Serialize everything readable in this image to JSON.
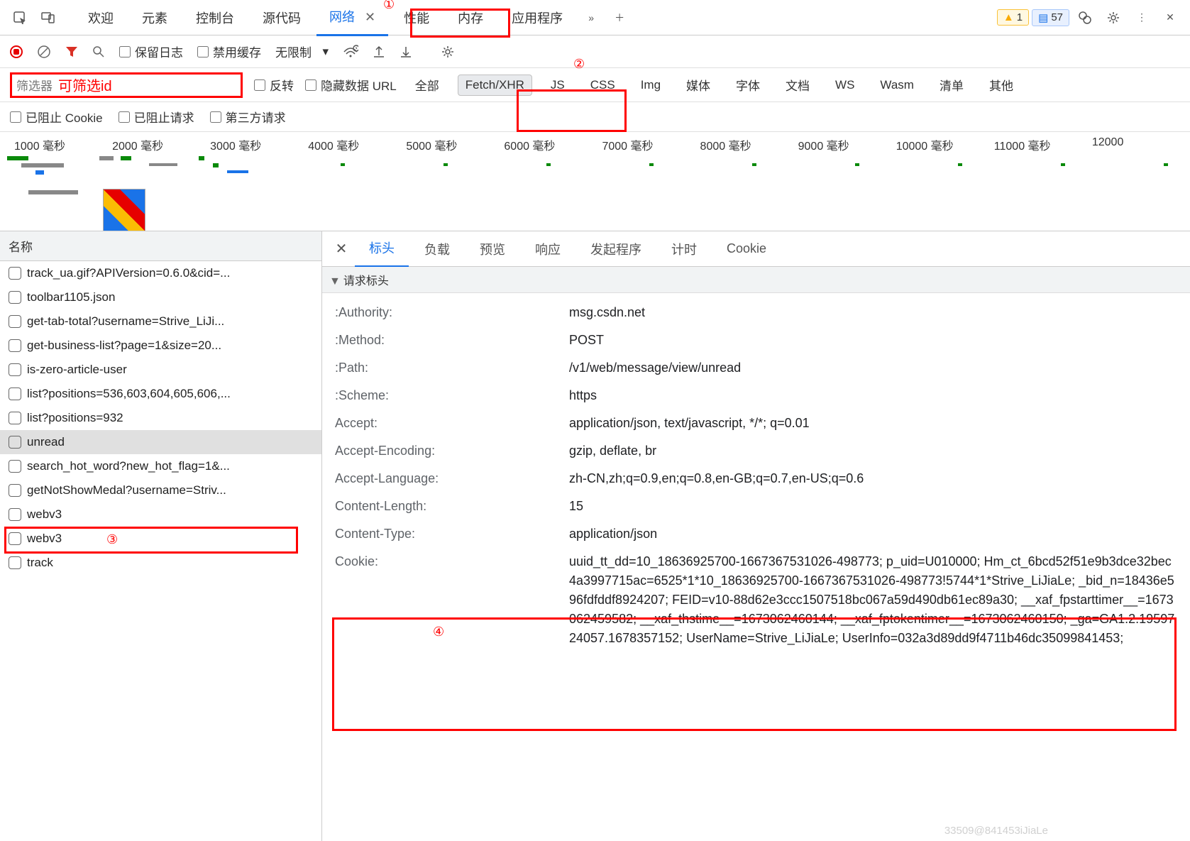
{
  "topbar": {
    "tabs": [
      "欢迎",
      "元素",
      "控制台",
      "源代码",
      "网络",
      "性能",
      "内存",
      "应用程序"
    ],
    "active_tab": "网络",
    "warn_count": "1",
    "msg_count": "57"
  },
  "toolbar": {
    "preserve_log": "保留日志",
    "disable_cache": "禁用缓存",
    "throttle": "无限制"
  },
  "filterrow": {
    "placeholder": "筛选器",
    "annotation": "可筛选id",
    "invert": "反转",
    "hide_data": "隐藏数据 URL",
    "types": [
      "全部",
      "Fetch/XHR",
      "JS",
      "CSS",
      "Img",
      "媒体",
      "字体",
      "文档",
      "WS",
      "Wasm",
      "清单",
      "其他"
    ],
    "selected_type": "Fetch/XHR"
  },
  "blockedrow": {
    "blocked_cookie": "已阻止 Cookie",
    "blocked_req": "已阻止请求",
    "third_party": "第三方请求"
  },
  "timeline": {
    "ticks": [
      "1000 毫秒",
      "2000 毫秒",
      "3000 毫秒",
      "4000 毫秒",
      "5000 毫秒",
      "6000 毫秒",
      "7000 毫秒",
      "8000 毫秒",
      "9000 毫秒",
      "10000 毫秒",
      "11000 毫秒",
      "12000"
    ]
  },
  "names": {
    "header": "名称",
    "items": [
      "track_ua.gif?APIVersion=0.6.0&cid=...",
      "toolbar1105.json",
      "get-tab-total?username=Strive_LiJi...",
      "get-business-list?page=1&size=20...",
      "is-zero-article-user",
      "list?positions=536,603,604,605,606,...",
      "list?positions=932",
      "unread",
      "search_hot_word?new_hot_flag=1&...",
      "getNotShowMedal?username=Striv...",
      "webv3",
      "webv3",
      "track"
    ],
    "selected": "unread"
  },
  "details": {
    "tabs": [
      "标头",
      "负载",
      "预览",
      "响应",
      "发起程序",
      "计时",
      "Cookie"
    ],
    "active": "标头",
    "section": "请求标头",
    "headers": [
      {
        "k": ":Authority:",
        "v": "msg.csdn.net"
      },
      {
        "k": ":Method:",
        "v": "POST"
      },
      {
        "k": ":Path:",
        "v": "/v1/web/message/view/unread"
      },
      {
        "k": ":Scheme:",
        "v": "https"
      },
      {
        "k": "Accept:",
        "v": "application/json, text/javascript, */*; q=0.01"
      },
      {
        "k": "Accept-Encoding:",
        "v": "gzip, deflate, br"
      },
      {
        "k": "Accept-Language:",
        "v": "zh-CN,zh;q=0.9,en;q=0.8,en-GB;q=0.7,en-US;q=0.6"
      },
      {
        "k": "Content-Length:",
        "v": "15"
      },
      {
        "k": "Content-Type:",
        "v": "application/json"
      },
      {
        "k": "Cookie:",
        "v": "uuid_tt_dd=10_18636925700-1667367531026-498773; p_uid=U010000; Hm_ct_6bcd52f51e9b3dce32bec4a3997715ac=6525*1*10_18636925700-1667367531026-498773!5744*1*Strive_LiJiaLe; _bid_n=18436e596fdfddf8924207; FEID=v10-88d62e3ccc1507518bc067a59d490db61ec89a30; __xaf_fpstarttimer__=1673062459582; __xaf_thstime__=1673062460144; __xaf_fptokentimer__=1673062460150; _ga=GA1.2.1959724057.1678357152; UserName=Strive_LiJiaLe; UserInfo=032a3d89dd9f4711b46dc35099841453;"
      }
    ]
  },
  "annotations": {
    "a1": "①",
    "a2": "②",
    "a3": "③",
    "a4": "④"
  },
  "watermark": "33509@841453iJiaLe"
}
